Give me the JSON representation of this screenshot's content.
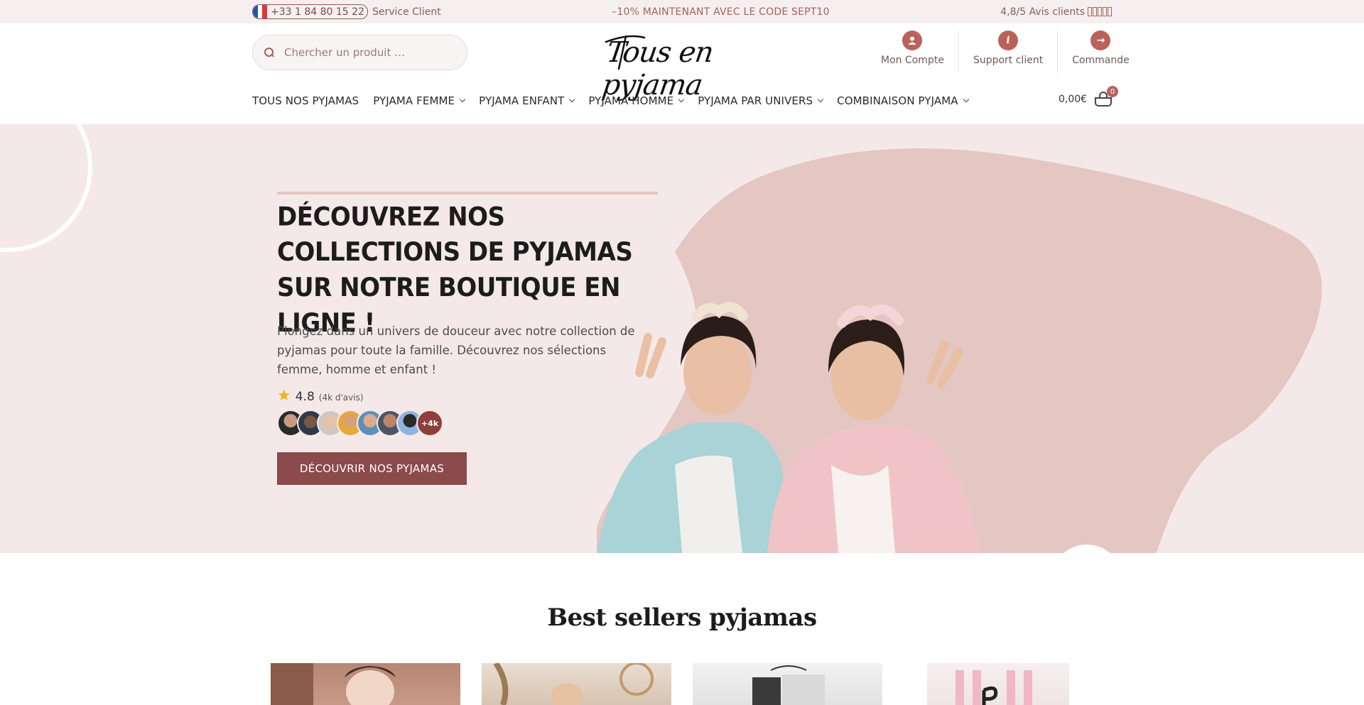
{
  "topbar": {
    "phone": "+33 1 84 80 15 22",
    "service": "Service Client",
    "promo": "–10% MAINTENANT AVEC LE CODE SEPT10",
    "reviews": "4,8/5 Avis clients"
  },
  "header": {
    "search_placeholder": "Chercher un produit …",
    "logo": "Tous en pyjama",
    "account": "Mon Compte",
    "support": "Support client",
    "order": "Commande",
    "cart_total": "0,00€",
    "cart_count": "0"
  },
  "nav": {
    "items": [
      {
        "label": "TOUS NOS PYJAMAS"
      },
      {
        "label": "PYJAMA FEMME"
      },
      {
        "label": "PYJAMA ENFANT"
      },
      {
        "label": "PYJAMA HOMME"
      },
      {
        "label": "PYJAMA PAR UNIVERS"
      },
      {
        "label": "COMBINAISON PYJAMA"
      }
    ]
  },
  "hero": {
    "title": "DÉCOUVREZ NOS COLLECTIONS DE PYJAMAS SUR NOTRE BOUTIQUE EN LIGNE !",
    "description": "Plongez dans un univers de douceur avec notre collection de pyjamas pour toute la famille. Découvrez nos sélections femme, homme et enfant !",
    "rating": "4.8",
    "rating_count": "(4k d'avis)",
    "avatars_more": "+4k",
    "cta": "DÉCOUVRIR NOS PYJAMAS"
  },
  "best_sellers": {
    "title": "Best sellers pyjamas"
  },
  "colors": {
    "accent": "#8b4a4c",
    "hero_bg": "#f4e9e8",
    "blob": "#e4c6c2",
    "icon_circle": "#b9625a"
  }
}
